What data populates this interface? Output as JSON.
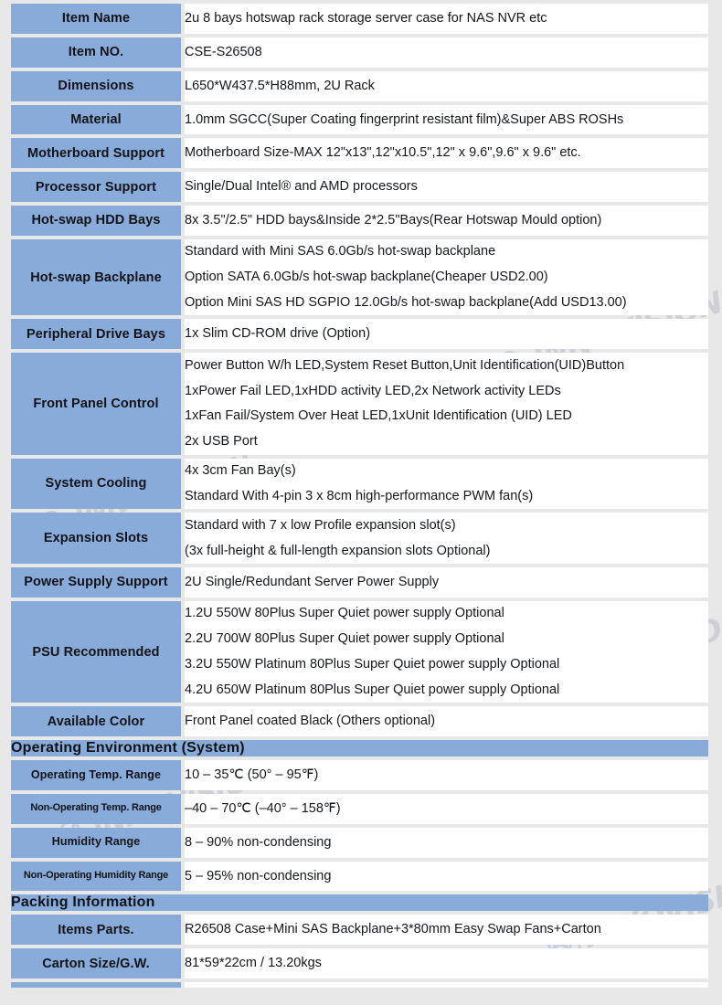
{
  "watermark": {
    "text": "INNOVISION",
    "logo_icon": "innovision-logo-icon",
    "color": "#b9bcc4",
    "logo_color": "#aab6d8"
  },
  "theme": {
    "label_bg": "#88abd9",
    "value_bg": "#ffffff",
    "page_bg": "#e8e8e8",
    "text_color": "#14171c"
  },
  "rows": [
    {
      "label": "Item Name",
      "values": [
        "2u 8 bays hotswap rack storage server case for NAS NVR etc"
      ]
    },
    {
      "label": "Item NO.",
      "values": [
        "CSE-S26508"
      ]
    },
    {
      "label": "Dimensions",
      "values": [
        "L650*W437.5*H88mm, 2U Rack"
      ]
    },
    {
      "label": "Material",
      "values": [
        "1.0mm SGCC(Super Coating fingerprint resistant film)&Super ABS ROSHs"
      ]
    },
    {
      "label": "Motherboard Support",
      "values": [
        "Motherboard Size-MAX 12\"x13\",12\"x10.5\",12\" x 9.6\",9.6\" x 9.6\" etc."
      ]
    },
    {
      "label": "Processor Support",
      "values": [
        "Single/Dual Intel® and AMD processors"
      ]
    },
    {
      "label": "Hot-swap HDD Bays",
      "values": [
        "8x 3.5\"/2.5\" HDD bays&Inside 2*2.5\"Bays(Rear Hotswap Mould option)"
      ]
    },
    {
      "label": "Hot-swap Backplane",
      "values": [
        "Standard with Mini SAS 6.0Gb/s hot-swap backplane",
        "Option SATA 6.0Gb/s hot-swap backplane(Cheaper USD2.00)",
        "Option Mini SAS HD SGPIO 12.0Gb/s hot-swap backplane(Add USD13.00)"
      ]
    },
    {
      "label": "Peripheral Drive Bays",
      "values": [
        "1x Slim CD-ROM drive (Option)"
      ]
    },
    {
      "label": "Front Panel Control",
      "values": [
        "Power Button W/h LED,System Reset Button,Unit Identification(UID)Button",
        "1xPower Fail LED,1xHDD activity LED,2x Network activity LEDs",
        "1xFan Fail/System Over Heat LED,1xUnit Identification (UID) LED",
        "2x USB Port"
      ]
    },
    {
      "label": "System Cooling",
      "values": [
        "4x 3cm Fan Bay(s)",
        "Standard With 4-pin 3 x 8cm high-performance PWM fan(s)"
      ]
    },
    {
      "label": "Expansion Slots",
      "values": [
        "Standard with 7 x low Profile expansion slot(s)",
        "(3x full-height & full-length expansion slots Optional)"
      ]
    },
    {
      "label": "Power Supply Support",
      "values": [
        "2U Single/Redundant Server Power Supply"
      ]
    },
    {
      "label": "PSU Recommended",
      "values": [
        "1.2U 550W 80Plus Super Quiet power supply Optional",
        "2.2U 700W 80Plus Super Quiet power supply Optional",
        "3.2U 550W Platinum 80Plus Super Quiet power supply Optional",
        "4.2U 650W Platinum 80Plus Super Quiet power supply Optional"
      ]
    },
    {
      "label": "Available Color",
      "values": [
        "Front Panel coated Black (Others optional)"
      ]
    }
  ],
  "section_operating": {
    "title": "Operating Environment (System)",
    "rows": [
      {
        "label": "Operating Temp. Range",
        "value": "10 – 35℃ (50° – 95℉)"
      },
      {
        "label": "Non-Operating Temp. Range",
        "value": "–40 – 70℃ (–40° – 158℉)"
      },
      {
        "label": "Humidity Range",
        "value": "8 – 90% non-condensing"
      },
      {
        "label": "Non-Operating Humidity Range",
        "value": "5 – 95% non-condensing"
      }
    ]
  },
  "section_packing": {
    "title": "Packing Information",
    "rows": [
      {
        "label": "Items Parts.",
        "value": "R26508 Case+Mini SAS Backplane+3*80mm Easy Swap Fans+Carton"
      },
      {
        "label": "Carton Size/G.W.",
        "value": "81*59*22cm / 13.20kgs"
      }
    ]
  }
}
